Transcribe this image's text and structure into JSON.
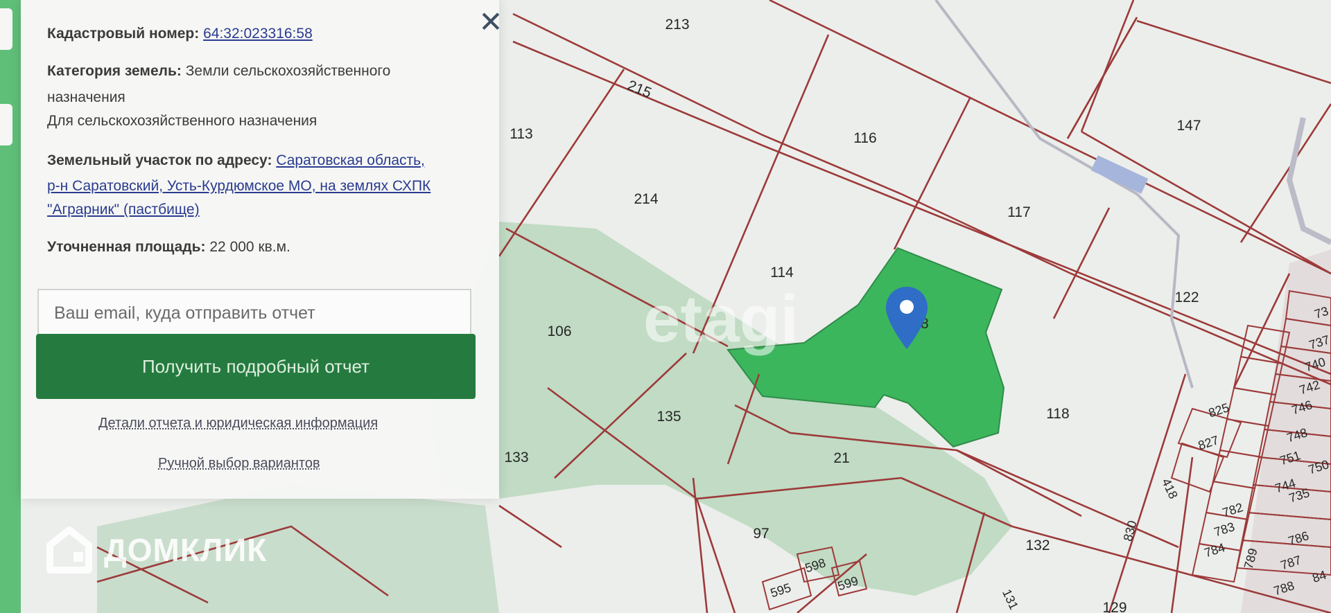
{
  "panel": {
    "cadastral_label": "Кадастровый номер:",
    "cadastral_number": "64:32:023316:58",
    "category_label": "Категория земель:",
    "category_value_line1": "Земли сельскохозяйственного",
    "category_value_line2": "назначения",
    "purpose": "Для сельскохозяйственного назначения",
    "address_label": "Земельный участок по адресу:",
    "address_line1": "Саратовская область,",
    "address_line2": "р-н Саратовский, Усть-Курдюмское МО, на землях СХПК",
    "address_line3": "\"Аграрник\" (пастбище)",
    "area_label": "Уточненная площадь:",
    "area_value": "22 000 кв.м.",
    "email_placeholder": "Ваш email, куда отправить отчет",
    "report_button": "Получить подробный отчет",
    "details_link": "Детали отчета и юридическая информация",
    "manual_link": "Ручной выбор вариантов",
    "close_icon": "close-icon"
  },
  "brand": {
    "name": "ДОМКЛИК",
    "icon": "house-logo-icon"
  },
  "watermark": "etagi",
  "map": {
    "marker_icon": "map-pin-icon",
    "selected_plot_color": "#39b65a",
    "boundary_color": "#9c3a3a",
    "plots": [
      "213",
      "215",
      "113",
      "116",
      "147",
      "214",
      "117",
      "114",
      "122",
      "106",
      "135",
      "118",
      "21",
      "133",
      "97",
      "132",
      "131",
      "129",
      "825",
      "827",
      "418",
      "830",
      "746",
      "748",
      "751",
      "744",
      "782",
      "783",
      "784",
      "786",
      "787",
      "788",
      "789",
      "742",
      "740",
      "737",
      "73",
      "750",
      "735",
      "595",
      "598",
      "599",
      "58",
      "84"
    ]
  }
}
